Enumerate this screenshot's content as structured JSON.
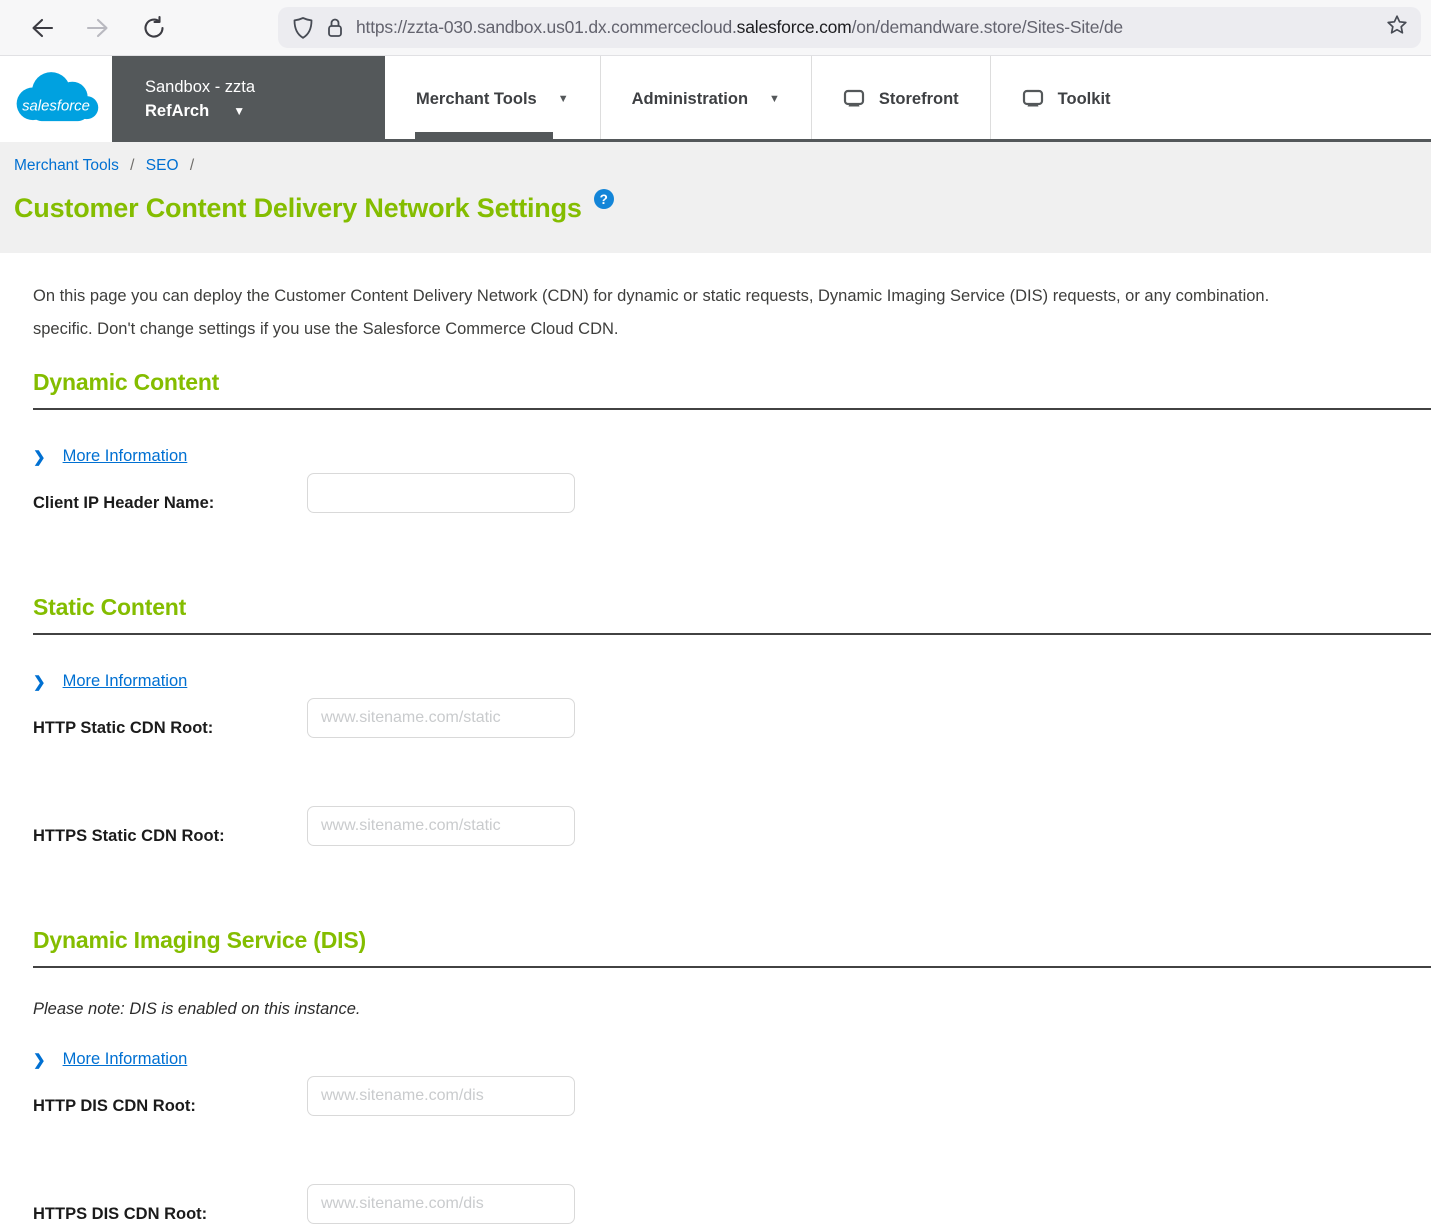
{
  "browser": {
    "url_prefix": "https://zzta-030.sandbox.us01.dx.commercecloud.",
    "url_domain": "salesforce.com",
    "url_path": "/on/demandware.store/Sites-Site/de"
  },
  "header": {
    "logo_text": "salesforce",
    "instance": {
      "line1": "Sandbox - zzta",
      "line2": "RefArch"
    },
    "nav": [
      {
        "label": "Merchant Tools"
      },
      {
        "label": "Administration"
      },
      {
        "label": "Storefront"
      },
      {
        "label": "Toolkit"
      }
    ]
  },
  "breadcrumb": {
    "items": [
      {
        "label": "Merchant Tools"
      },
      {
        "label": "SEO"
      }
    ],
    "separator": "/"
  },
  "page": {
    "title": "Customer Content Delivery Network Settings",
    "help": "?",
    "description_line1": "On this page you can deploy the Customer Content Delivery Network (CDN) for dynamic or static requests, Dynamic Imaging Service (DIS) requests, or any combination.",
    "description_line2": "specific. Don't change settings if you use the Salesforce Commerce Cloud CDN."
  },
  "sections": {
    "dynamic": {
      "title": "Dynamic Content",
      "more_info": "More Information",
      "fields": [
        {
          "label": "Client IP Header Name:",
          "value": "",
          "placeholder": ""
        }
      ]
    },
    "static": {
      "title": "Static Content",
      "more_info": "More Information",
      "fields": [
        {
          "label": "HTTP Static CDN Root:",
          "value": "",
          "placeholder": "www.sitename.com/static"
        },
        {
          "label": "HTTPS Static CDN Root:",
          "value": "",
          "placeholder": "www.sitename.com/static"
        }
      ]
    },
    "dis": {
      "title": "Dynamic Imaging Service (DIS)",
      "note": "Please note: DIS is enabled on this instance.",
      "more_info": "More Information",
      "fields": [
        {
          "label": "HTTP DIS CDN Root:",
          "value": "",
          "placeholder": "www.sitename.com/dis"
        },
        {
          "label": "HTTPS DIS CDN Root:",
          "value": "",
          "placeholder": "www.sitename.com/dis"
        }
      ]
    }
  },
  "colors": {
    "accent_green": "#84BD00",
    "link_blue": "#0070D2",
    "header_dark_gray": "#54585A",
    "logo_blue": "#00A1E0",
    "help_blue": "#1385D8"
  }
}
